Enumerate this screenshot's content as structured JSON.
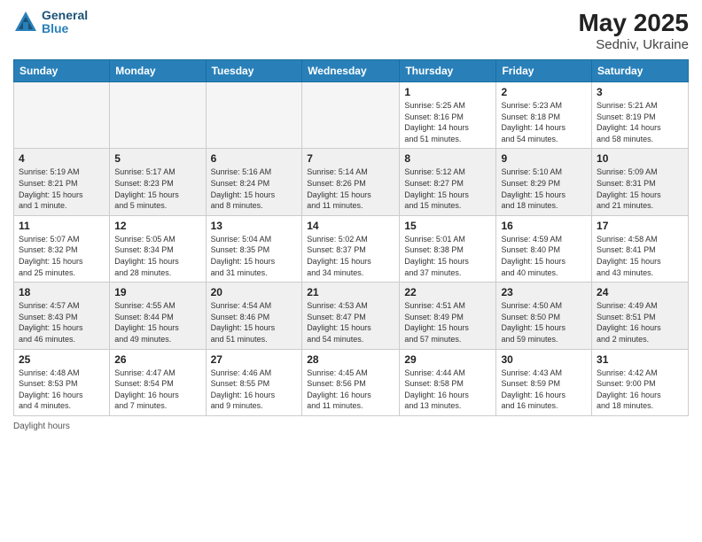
{
  "header": {
    "logo_line1": "General",
    "logo_line2": "Blue",
    "main_title": "May 2025",
    "sub_title": "Sedniv, Ukraine"
  },
  "columns": [
    "Sunday",
    "Monday",
    "Tuesday",
    "Wednesday",
    "Thursday",
    "Friday",
    "Saturday"
  ],
  "weeks": [
    {
      "days": [
        {
          "num": "",
          "info": ""
        },
        {
          "num": "",
          "info": ""
        },
        {
          "num": "",
          "info": ""
        },
        {
          "num": "",
          "info": ""
        },
        {
          "num": "1",
          "info": "Sunrise: 5:25 AM\nSunset: 8:16 PM\nDaylight: 14 hours\nand 51 minutes."
        },
        {
          "num": "2",
          "info": "Sunrise: 5:23 AM\nSunset: 8:18 PM\nDaylight: 14 hours\nand 54 minutes."
        },
        {
          "num": "3",
          "info": "Sunrise: 5:21 AM\nSunset: 8:19 PM\nDaylight: 14 hours\nand 58 minutes."
        }
      ]
    },
    {
      "days": [
        {
          "num": "4",
          "info": "Sunrise: 5:19 AM\nSunset: 8:21 PM\nDaylight: 15 hours\nand 1 minute."
        },
        {
          "num": "5",
          "info": "Sunrise: 5:17 AM\nSunset: 8:23 PM\nDaylight: 15 hours\nand 5 minutes."
        },
        {
          "num": "6",
          "info": "Sunrise: 5:16 AM\nSunset: 8:24 PM\nDaylight: 15 hours\nand 8 minutes."
        },
        {
          "num": "7",
          "info": "Sunrise: 5:14 AM\nSunset: 8:26 PM\nDaylight: 15 hours\nand 11 minutes."
        },
        {
          "num": "8",
          "info": "Sunrise: 5:12 AM\nSunset: 8:27 PM\nDaylight: 15 hours\nand 15 minutes."
        },
        {
          "num": "9",
          "info": "Sunrise: 5:10 AM\nSunset: 8:29 PM\nDaylight: 15 hours\nand 18 minutes."
        },
        {
          "num": "10",
          "info": "Sunrise: 5:09 AM\nSunset: 8:31 PM\nDaylight: 15 hours\nand 21 minutes."
        }
      ]
    },
    {
      "days": [
        {
          "num": "11",
          "info": "Sunrise: 5:07 AM\nSunset: 8:32 PM\nDaylight: 15 hours\nand 25 minutes."
        },
        {
          "num": "12",
          "info": "Sunrise: 5:05 AM\nSunset: 8:34 PM\nDaylight: 15 hours\nand 28 minutes."
        },
        {
          "num": "13",
          "info": "Sunrise: 5:04 AM\nSunset: 8:35 PM\nDaylight: 15 hours\nand 31 minutes."
        },
        {
          "num": "14",
          "info": "Sunrise: 5:02 AM\nSunset: 8:37 PM\nDaylight: 15 hours\nand 34 minutes."
        },
        {
          "num": "15",
          "info": "Sunrise: 5:01 AM\nSunset: 8:38 PM\nDaylight: 15 hours\nand 37 minutes."
        },
        {
          "num": "16",
          "info": "Sunrise: 4:59 AM\nSunset: 8:40 PM\nDaylight: 15 hours\nand 40 minutes."
        },
        {
          "num": "17",
          "info": "Sunrise: 4:58 AM\nSunset: 8:41 PM\nDaylight: 15 hours\nand 43 minutes."
        }
      ]
    },
    {
      "days": [
        {
          "num": "18",
          "info": "Sunrise: 4:57 AM\nSunset: 8:43 PM\nDaylight: 15 hours\nand 46 minutes."
        },
        {
          "num": "19",
          "info": "Sunrise: 4:55 AM\nSunset: 8:44 PM\nDaylight: 15 hours\nand 49 minutes."
        },
        {
          "num": "20",
          "info": "Sunrise: 4:54 AM\nSunset: 8:46 PM\nDaylight: 15 hours\nand 51 minutes."
        },
        {
          "num": "21",
          "info": "Sunrise: 4:53 AM\nSunset: 8:47 PM\nDaylight: 15 hours\nand 54 minutes."
        },
        {
          "num": "22",
          "info": "Sunrise: 4:51 AM\nSunset: 8:49 PM\nDaylight: 15 hours\nand 57 minutes."
        },
        {
          "num": "23",
          "info": "Sunrise: 4:50 AM\nSunset: 8:50 PM\nDaylight: 15 hours\nand 59 minutes."
        },
        {
          "num": "24",
          "info": "Sunrise: 4:49 AM\nSunset: 8:51 PM\nDaylight: 16 hours\nand 2 minutes."
        }
      ]
    },
    {
      "days": [
        {
          "num": "25",
          "info": "Sunrise: 4:48 AM\nSunset: 8:53 PM\nDaylight: 16 hours\nand 4 minutes."
        },
        {
          "num": "26",
          "info": "Sunrise: 4:47 AM\nSunset: 8:54 PM\nDaylight: 16 hours\nand 7 minutes."
        },
        {
          "num": "27",
          "info": "Sunrise: 4:46 AM\nSunset: 8:55 PM\nDaylight: 16 hours\nand 9 minutes."
        },
        {
          "num": "28",
          "info": "Sunrise: 4:45 AM\nSunset: 8:56 PM\nDaylight: 16 hours\nand 11 minutes."
        },
        {
          "num": "29",
          "info": "Sunrise: 4:44 AM\nSunset: 8:58 PM\nDaylight: 16 hours\nand 13 minutes."
        },
        {
          "num": "30",
          "info": "Sunrise: 4:43 AM\nSunset: 8:59 PM\nDaylight: 16 hours\nand 16 minutes."
        },
        {
          "num": "31",
          "info": "Sunrise: 4:42 AM\nSunset: 9:00 PM\nDaylight: 16 hours\nand 18 minutes."
        }
      ]
    }
  ],
  "footer": {
    "daylight_label": "Daylight hours"
  }
}
